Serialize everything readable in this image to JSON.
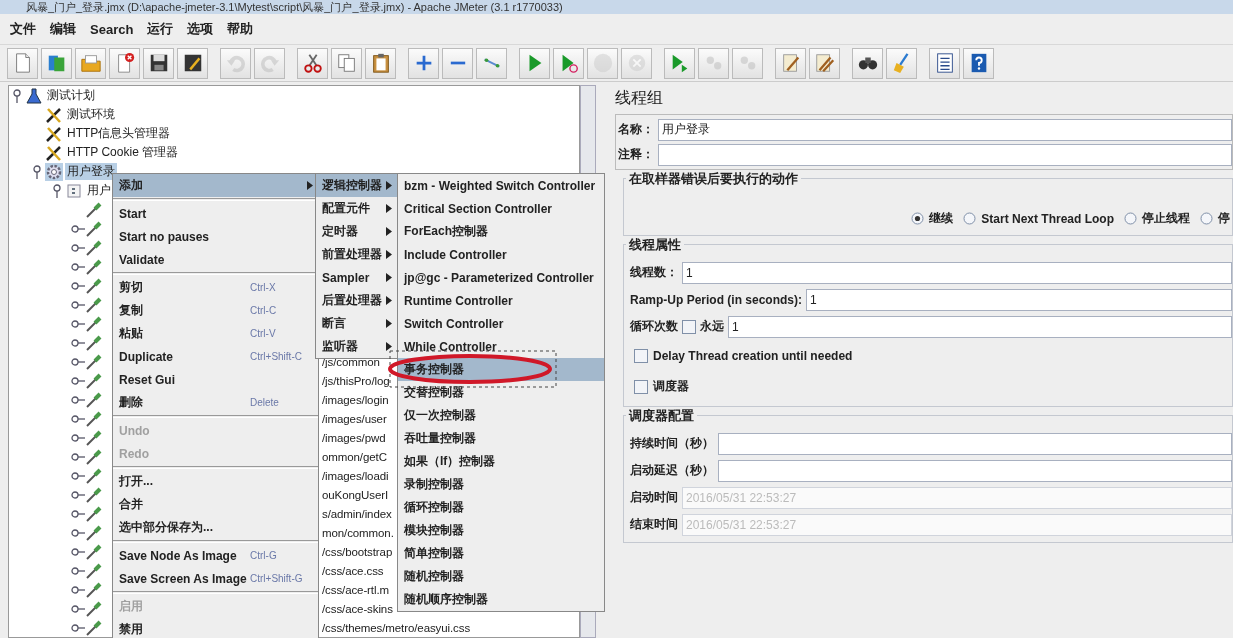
{
  "window": {
    "title": "风暴_门户_登录.jmx (D:\\apache-jmeter-3.1\\Mytest\\script\\风暴_门户_登录.jmx) - Apache JMeter (3.1 r1770033)"
  },
  "menubar": [
    "文件",
    "编辑",
    "Search",
    "运行",
    "选项",
    "帮助"
  ],
  "toolbar": [
    [
      {
        "kind": "new",
        "disabled": false
      },
      {
        "kind": "templates",
        "disabled": false
      },
      {
        "kind": "open",
        "disabled": false
      },
      {
        "kind": "close",
        "disabled": false
      },
      {
        "kind": "save",
        "disabled": false
      },
      {
        "kind": "saveimage",
        "disabled": false
      }
    ],
    [
      {
        "kind": "undo",
        "disabled": true
      },
      {
        "kind": "redo",
        "disabled": true
      }
    ],
    [
      {
        "kind": "cut",
        "disabled": false
      },
      {
        "kind": "copy",
        "disabled": false
      },
      {
        "kind": "paste",
        "disabled": false
      }
    ],
    [
      {
        "kind": "expand",
        "disabled": false
      },
      {
        "kind": "collapse",
        "disabled": false
      },
      {
        "kind": "toggle",
        "disabled": false
      }
    ],
    [
      {
        "kind": "start",
        "disabled": false
      },
      {
        "kind": "startnopause",
        "disabled": false
      },
      {
        "kind": "stop",
        "disabled": true
      },
      {
        "kind": "shutdown",
        "disabled": true
      }
    ],
    [
      {
        "kind": "remotestart",
        "disabled": false
      },
      {
        "kind": "remotestop",
        "disabled": true
      },
      {
        "kind": "remoteexit",
        "disabled": true
      }
    ],
    [
      {
        "kind": "clear",
        "disabled": false
      },
      {
        "kind": "clearall",
        "disabled": false
      }
    ],
    [
      {
        "kind": "search",
        "disabled": false
      },
      {
        "kind": "reset",
        "disabled": false
      }
    ],
    [
      {
        "kind": "functions",
        "disabled": false
      },
      {
        "kind": "help",
        "disabled": false
      }
    ]
  ],
  "tree": {
    "items": [
      {
        "label": "测试计划",
        "kind": "plan",
        "selected": false,
        "expanded": true,
        "children": [
          {
            "label": "测试环境",
            "kind": "config",
            "selected": false
          },
          {
            "label": "HTTP信息头管理器",
            "kind": "config",
            "selected": false
          },
          {
            "label": "HTTP Cookie 管理器",
            "kind": "config",
            "selected": false
          },
          {
            "label": "用户登录",
            "kind": "threadgroup",
            "selected": true,
            "expanded": true,
            "children": [
              {
                "label": "用户",
                "kind": "controller",
                "selected": false,
                "expanded": true,
                "children": [
                  {
                    "kind": "sampler",
                    "selected": false
                  },
                  {
                    "kind": "sampler",
                    "selected": false,
                    "expanded": false
                  },
                  {
                    "kind": "sampler",
                    "selected": false,
                    "expanded": false
                  },
                  {
                    "kind": "sampler",
                    "selected": false,
                    "expanded": false
                  },
                  {
                    "kind": "sampler",
                    "selected": false,
                    "expanded": false
                  },
                  {
                    "kind": "sampler",
                    "selected": false,
                    "expanded": false
                  },
                  {
                    "kind": "sampler",
                    "selected": false,
                    "expanded": false
                  },
                  {
                    "kind": "sampler",
                    "selected": false,
                    "expanded": false
                  },
                  {
                    "kind": "sampler",
                    "label": "/js/common",
                    "selected": false,
                    "expanded": false
                  },
                  {
                    "kind": "sampler",
                    "label": "/js/thisPro/log",
                    "selected": false,
                    "expanded": false
                  },
                  {
                    "kind": "sampler",
                    "label": "/images/login",
                    "selected": false,
                    "expanded": false
                  },
                  {
                    "kind": "sampler",
                    "label": "/images/user",
                    "selected": false,
                    "expanded": false
                  },
                  {
                    "kind": "sampler",
                    "label": "/images/pwd",
                    "selected": false,
                    "expanded": false
                  },
                  {
                    "kind": "sampler",
                    "label": "ommon/getC",
                    "selected": false,
                    "expanded": false
                  },
                  {
                    "kind": "sampler",
                    "label": "/images/loadi",
                    "selected": false,
                    "expanded": false
                  },
                  {
                    "kind": "sampler",
                    "label": "ouKongUserI",
                    "selected": false,
                    "expanded": false
                  },
                  {
                    "kind": "sampler",
                    "label": "s/admin/index",
                    "selected": false,
                    "expanded": false
                  },
                  {
                    "kind": "sampler",
                    "label": "mon/common.",
                    "selected": false,
                    "expanded": false
                  },
                  {
                    "kind": "sampler",
                    "label": "/css/bootstrap",
                    "selected": false,
                    "expanded": false
                  },
                  {
                    "kind": "sampler",
                    "label": "/css/ace.css",
                    "selected": false,
                    "expanded": false
                  },
                  {
                    "kind": "sampler",
                    "label": "/css/ace-rtl.m",
                    "selected": false,
                    "expanded": false
                  },
                  {
                    "kind": "sampler",
                    "label": "/css/ace-skins",
                    "selected": false,
                    "expanded": false
                  },
                  {
                    "kind": "sampler",
                    "label": "/css/themes/metro/easyui.css",
                    "selected": false,
                    "expanded": false
                  }
                ]
              }
            ]
          }
        ]
      }
    ]
  },
  "context_menu": {
    "groups": [
      [
        {
          "label": "添加",
          "submenu": true,
          "selected": true,
          "disabled": false
        }
      ],
      [
        {
          "label": "Start",
          "selected": false,
          "disabled": false
        },
        {
          "label": "Start no pauses",
          "selected": false,
          "disabled": false
        },
        {
          "label": "Validate",
          "selected": false,
          "disabled": false
        }
      ],
      [
        {
          "label": "剪切",
          "shortcut": "Ctrl-X",
          "selected": false,
          "disabled": false
        },
        {
          "label": "复制",
          "shortcut": "Ctrl-C",
          "selected": false,
          "disabled": false
        },
        {
          "label": "粘贴",
          "shortcut": "Ctrl-V",
          "selected": false,
          "disabled": false
        },
        {
          "label": "Duplicate",
          "shortcut": "Ctrl+Shift-C",
          "selected": false,
          "disabled": false
        },
        {
          "label": "Reset Gui",
          "selected": false,
          "disabled": false
        },
        {
          "label": "删除",
          "shortcut": "Delete",
          "selected": false,
          "disabled": false
        }
      ],
      [
        {
          "label": "Undo",
          "selected": false,
          "disabled": true
        },
        {
          "label": "Redo",
          "selected": false,
          "disabled": true
        }
      ],
      [
        {
          "label": "打开...",
          "selected": false,
          "disabled": false
        },
        {
          "label": "合并",
          "selected": false,
          "disabled": false
        },
        {
          "label": "选中部分保存为...",
          "selected": false,
          "disabled": false
        }
      ],
      [
        {
          "label": "Save Node As Image",
          "shortcut": "Ctrl-G",
          "selected": false,
          "disabled": false
        },
        {
          "label": "Save Screen As Image",
          "shortcut": "Ctrl+Shift-G",
          "selected": false,
          "disabled": false
        }
      ],
      [
        {
          "label": "启用",
          "selected": false,
          "disabled": true
        },
        {
          "label": "禁用",
          "selected": false,
          "disabled": false
        }
      ]
    ]
  },
  "add_menu": {
    "items": [
      {
        "label": "逻辑控制器",
        "selected": true
      },
      {
        "label": "配置元件",
        "selected": false
      },
      {
        "label": "定时器",
        "selected": false
      },
      {
        "label": "前置处理器",
        "selected": false
      },
      {
        "label": "Sampler",
        "selected": false
      },
      {
        "label": "后置处理器",
        "selected": false
      },
      {
        "label": "断言",
        "selected": false
      },
      {
        "label": "监听器",
        "selected": false
      }
    ]
  },
  "controller_menu": {
    "items": [
      {
        "label": "bzm - Weighted Switch Controller",
        "selected": false
      },
      {
        "label": "Critical Section Controller",
        "selected": false
      },
      {
        "label": "ForEach控制器",
        "selected": false
      },
      {
        "label": "Include Controller",
        "selected": false
      },
      {
        "label": "jp@gc - Parameterized Controller",
        "selected": false
      },
      {
        "label": "Runtime Controller",
        "selected": false
      },
      {
        "label": "Switch Controller",
        "selected": false
      },
      {
        "label": "While Controller",
        "selected": false
      },
      {
        "label": "事务控制器",
        "selected": true
      },
      {
        "label": "交替控制器",
        "selected": false
      },
      {
        "label": "仅一次控制器",
        "selected": false
      },
      {
        "label": "吞吐量控制器",
        "selected": false
      },
      {
        "label": "如果（If）控制器",
        "selected": false
      },
      {
        "label": "录制控制器",
        "selected": false
      },
      {
        "label": "循环控制器",
        "selected": false
      },
      {
        "label": "模块控制器",
        "selected": false
      },
      {
        "label": "简单控制器",
        "selected": false
      },
      {
        "label": "随机控制器",
        "selected": false
      },
      {
        "label": "随机顺序控制器",
        "selected": false
      }
    ]
  },
  "panel": {
    "title": "线程组",
    "name_label": "名称：",
    "name_value": "用户登录",
    "comment_label": "注释：",
    "error_action": {
      "legend": "在取样器错误后要执行的动作",
      "options": [
        {
          "label": "继续",
          "selected": true
        },
        {
          "label": "Start Next Thread Loop",
          "selected": false
        },
        {
          "label": "停止线程",
          "selected": false
        },
        {
          "label": "停",
          "selected": false
        }
      ]
    },
    "thread_props": {
      "legend": "线程属性",
      "threads_label": "线程数：",
      "threads_value": "1",
      "rampup_label": "Ramp-Up Period (in seconds):",
      "rampup_value": "1",
      "loop_label": "循环次数",
      "forever": {
        "label": "永远",
        "checked": false
      },
      "loop_value": "1",
      "checks": [
        {
          "label": "Delay Thread creation until needed",
          "checked": false
        },
        {
          "label": "调度器",
          "checked": false
        }
      ]
    },
    "scheduler": {
      "legend": "调度器配置",
      "fields": [
        {
          "label": "持续时间（秒）",
          "disabled": false
        },
        {
          "label": "启动延迟（秒）",
          "disabled": false
        },
        {
          "label": "启动时间",
          "value": "2016/05/31 22:53:27",
          "disabled": true
        },
        {
          "label": "结束时间",
          "value": "2016/05/31 22:53:27",
          "disabled": true
        }
      ]
    }
  }
}
